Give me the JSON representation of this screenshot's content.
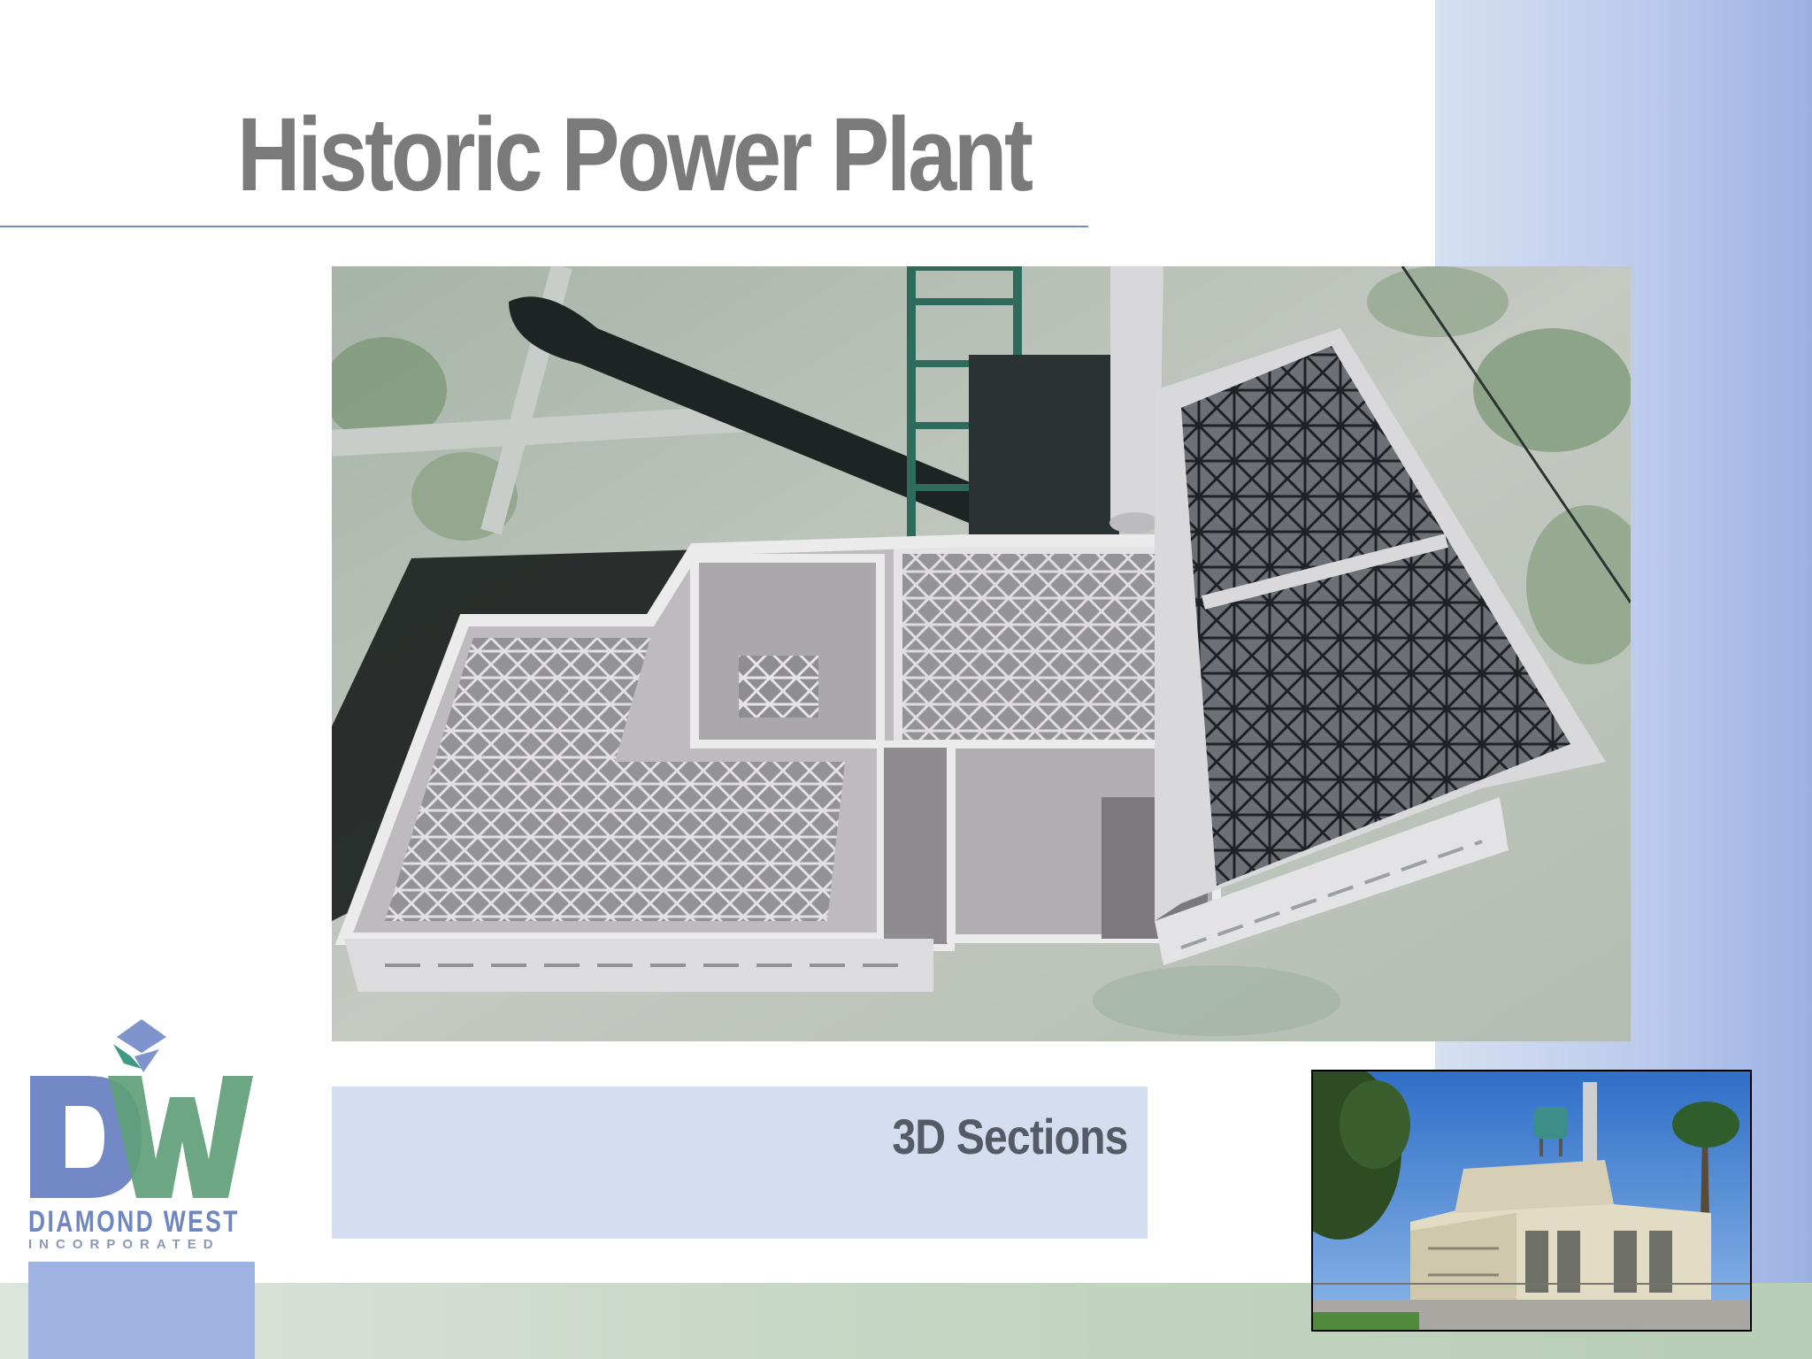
{
  "slide": {
    "title": "Historic Power Plant",
    "caption": "3D Sections"
  },
  "logo": {
    "monogram": "DW",
    "name": "DIAMOND WEST",
    "subtitle": "INCORPORATED",
    "colors": {
      "blue": "#6f86c0",
      "green": "#5f9e78",
      "teal": "#3e9a82"
    }
  },
  "images": {
    "main": "3d-section-render-icon",
    "photo": "power-plant-photo-icon"
  },
  "colors": {
    "title": "#7a7a7a",
    "rule": "#6f8fbf",
    "caption_bg": "#d4def0",
    "caption_text": "#555b66"
  }
}
